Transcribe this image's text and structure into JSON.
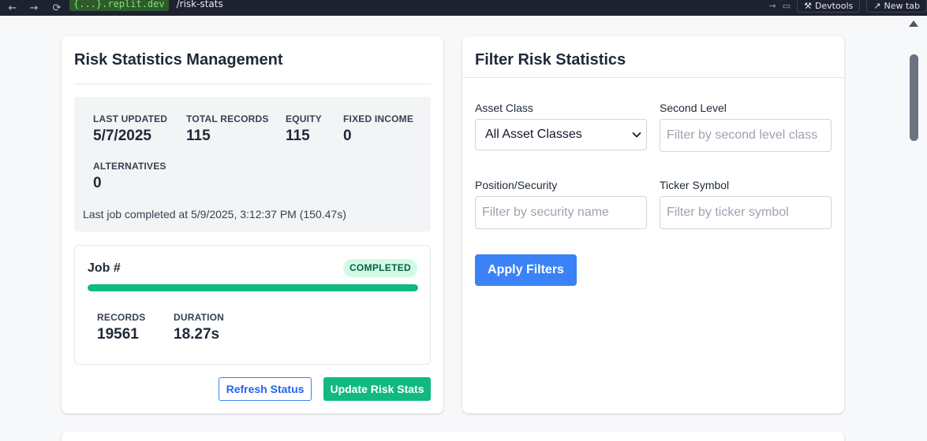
{
  "browser": {
    "url_host": "{...}.replit.dev",
    "url_path": "/risk-stats",
    "devtools_label": "Devtools",
    "new_tab_label": "New tab"
  },
  "management": {
    "title": "Risk Statistics Management",
    "stats": {
      "last_updated_label": "LAST UPDATED",
      "last_updated_value": "5/7/2025",
      "total_records_label": "TOTAL RECORDS",
      "total_records_value": "115",
      "equity_label": "EQUITY",
      "equity_value": "115",
      "fixed_income_label": "FIXED INCOME",
      "fixed_income_value": "0",
      "alternatives_label": "ALTERNATIVES",
      "alternatives_value": "0"
    },
    "last_job_text": "Last job completed at 5/9/2025, 3:12:37 PM (150.47s)",
    "job": {
      "title": "Job #",
      "status": "COMPLETED",
      "progress": 1.0,
      "records_label": "RECORDS",
      "records_value": "19561",
      "duration_label": "DURATION",
      "duration_value": "18.27s"
    },
    "refresh_label": "Refresh Status",
    "update_label": "Update Risk Stats"
  },
  "filter": {
    "title": "Filter Risk Statistics",
    "asset_class_label": "Asset Class",
    "asset_class_value": "All Asset Classes",
    "second_level_label": "Second Level",
    "second_level_placeholder": "Filter by second level class",
    "position_label": "Position/Security",
    "position_placeholder": "Filter by security name",
    "ticker_label": "Ticker Symbol",
    "ticker_placeholder": "Filter by ticker symbol",
    "apply_label": "Apply Filters"
  },
  "colors": {
    "accent_green": "#10b981",
    "accent_blue": "#3b82f6",
    "badge_bg": "#d1fae5"
  }
}
